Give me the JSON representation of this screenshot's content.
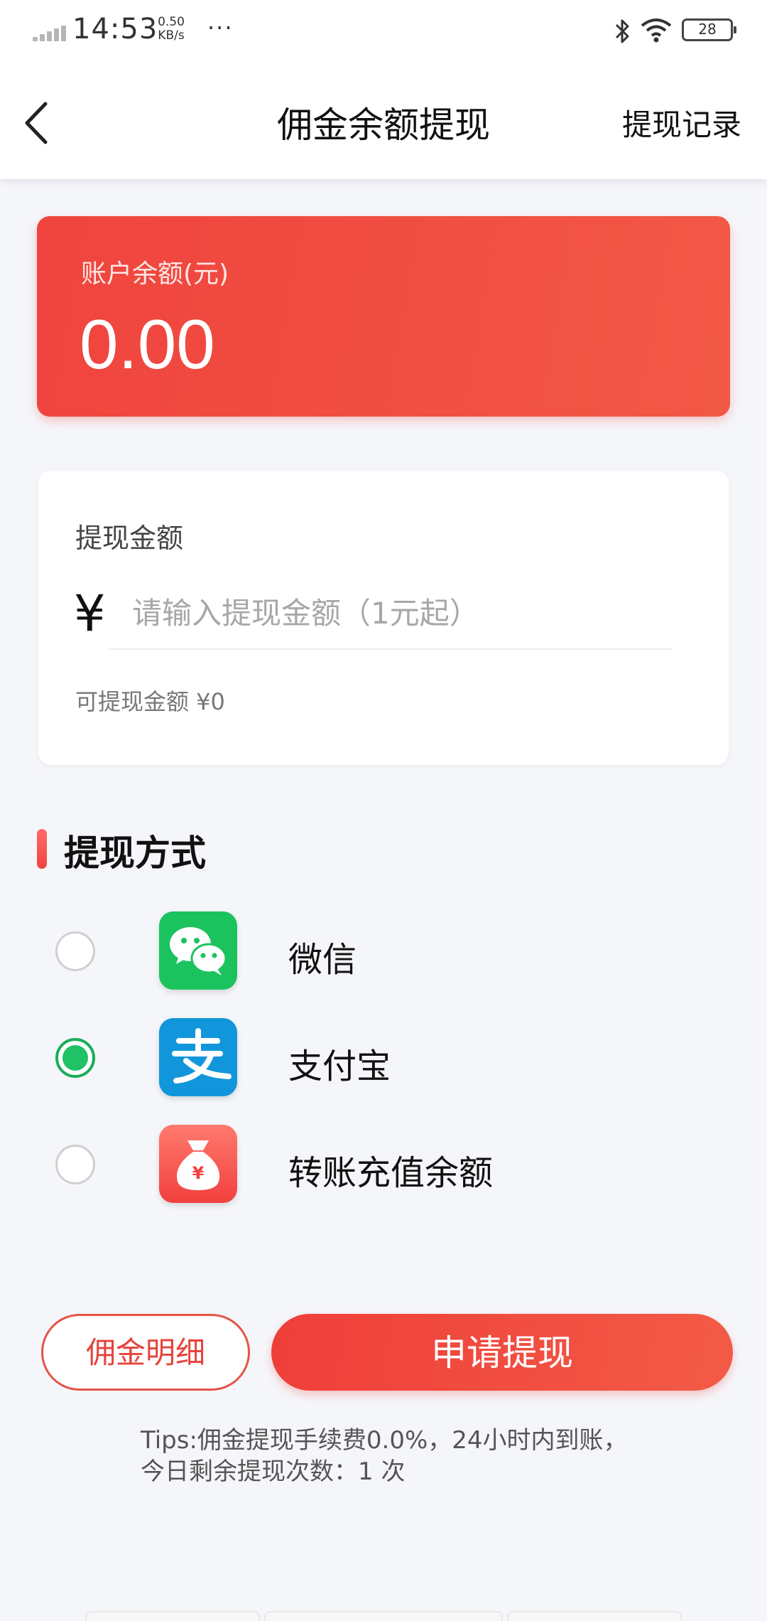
{
  "status_bar": {
    "time": "14:53",
    "net_speed_value": "0.50",
    "net_speed_unit": "KB/s",
    "more": "···",
    "battery": "28"
  },
  "nav": {
    "title": "佣金余额提现",
    "record_link": "提现记录"
  },
  "balance": {
    "label": "账户余额(元)",
    "value": "0.00"
  },
  "withdraw": {
    "label": "提现金额",
    "currency": "¥",
    "placeholder": "请输入提现金额（1元起）",
    "value": "",
    "available": "可提现金额 ¥0"
  },
  "methods": {
    "title": "提现方式",
    "items": [
      {
        "label": "微信",
        "icon": "wechat-icon",
        "selected": false
      },
      {
        "label": "支付宝",
        "icon": "alipay-icon",
        "selected": true
      },
      {
        "label": "转账充值余额",
        "icon": "money-bag-icon",
        "selected": false
      }
    ]
  },
  "buttons": {
    "detail": "佣金明细",
    "apply": "申请提现"
  },
  "tips": {
    "line1": "Tips:佣金提现手续费0.0%，24小时内到账，",
    "line2": "今日剩余提现次数：1 次"
  },
  "colors": {
    "accent": "#f0443e",
    "selected_radio": "#1fc265",
    "wechat": "#1bc35e",
    "alipay": "#1296db"
  }
}
